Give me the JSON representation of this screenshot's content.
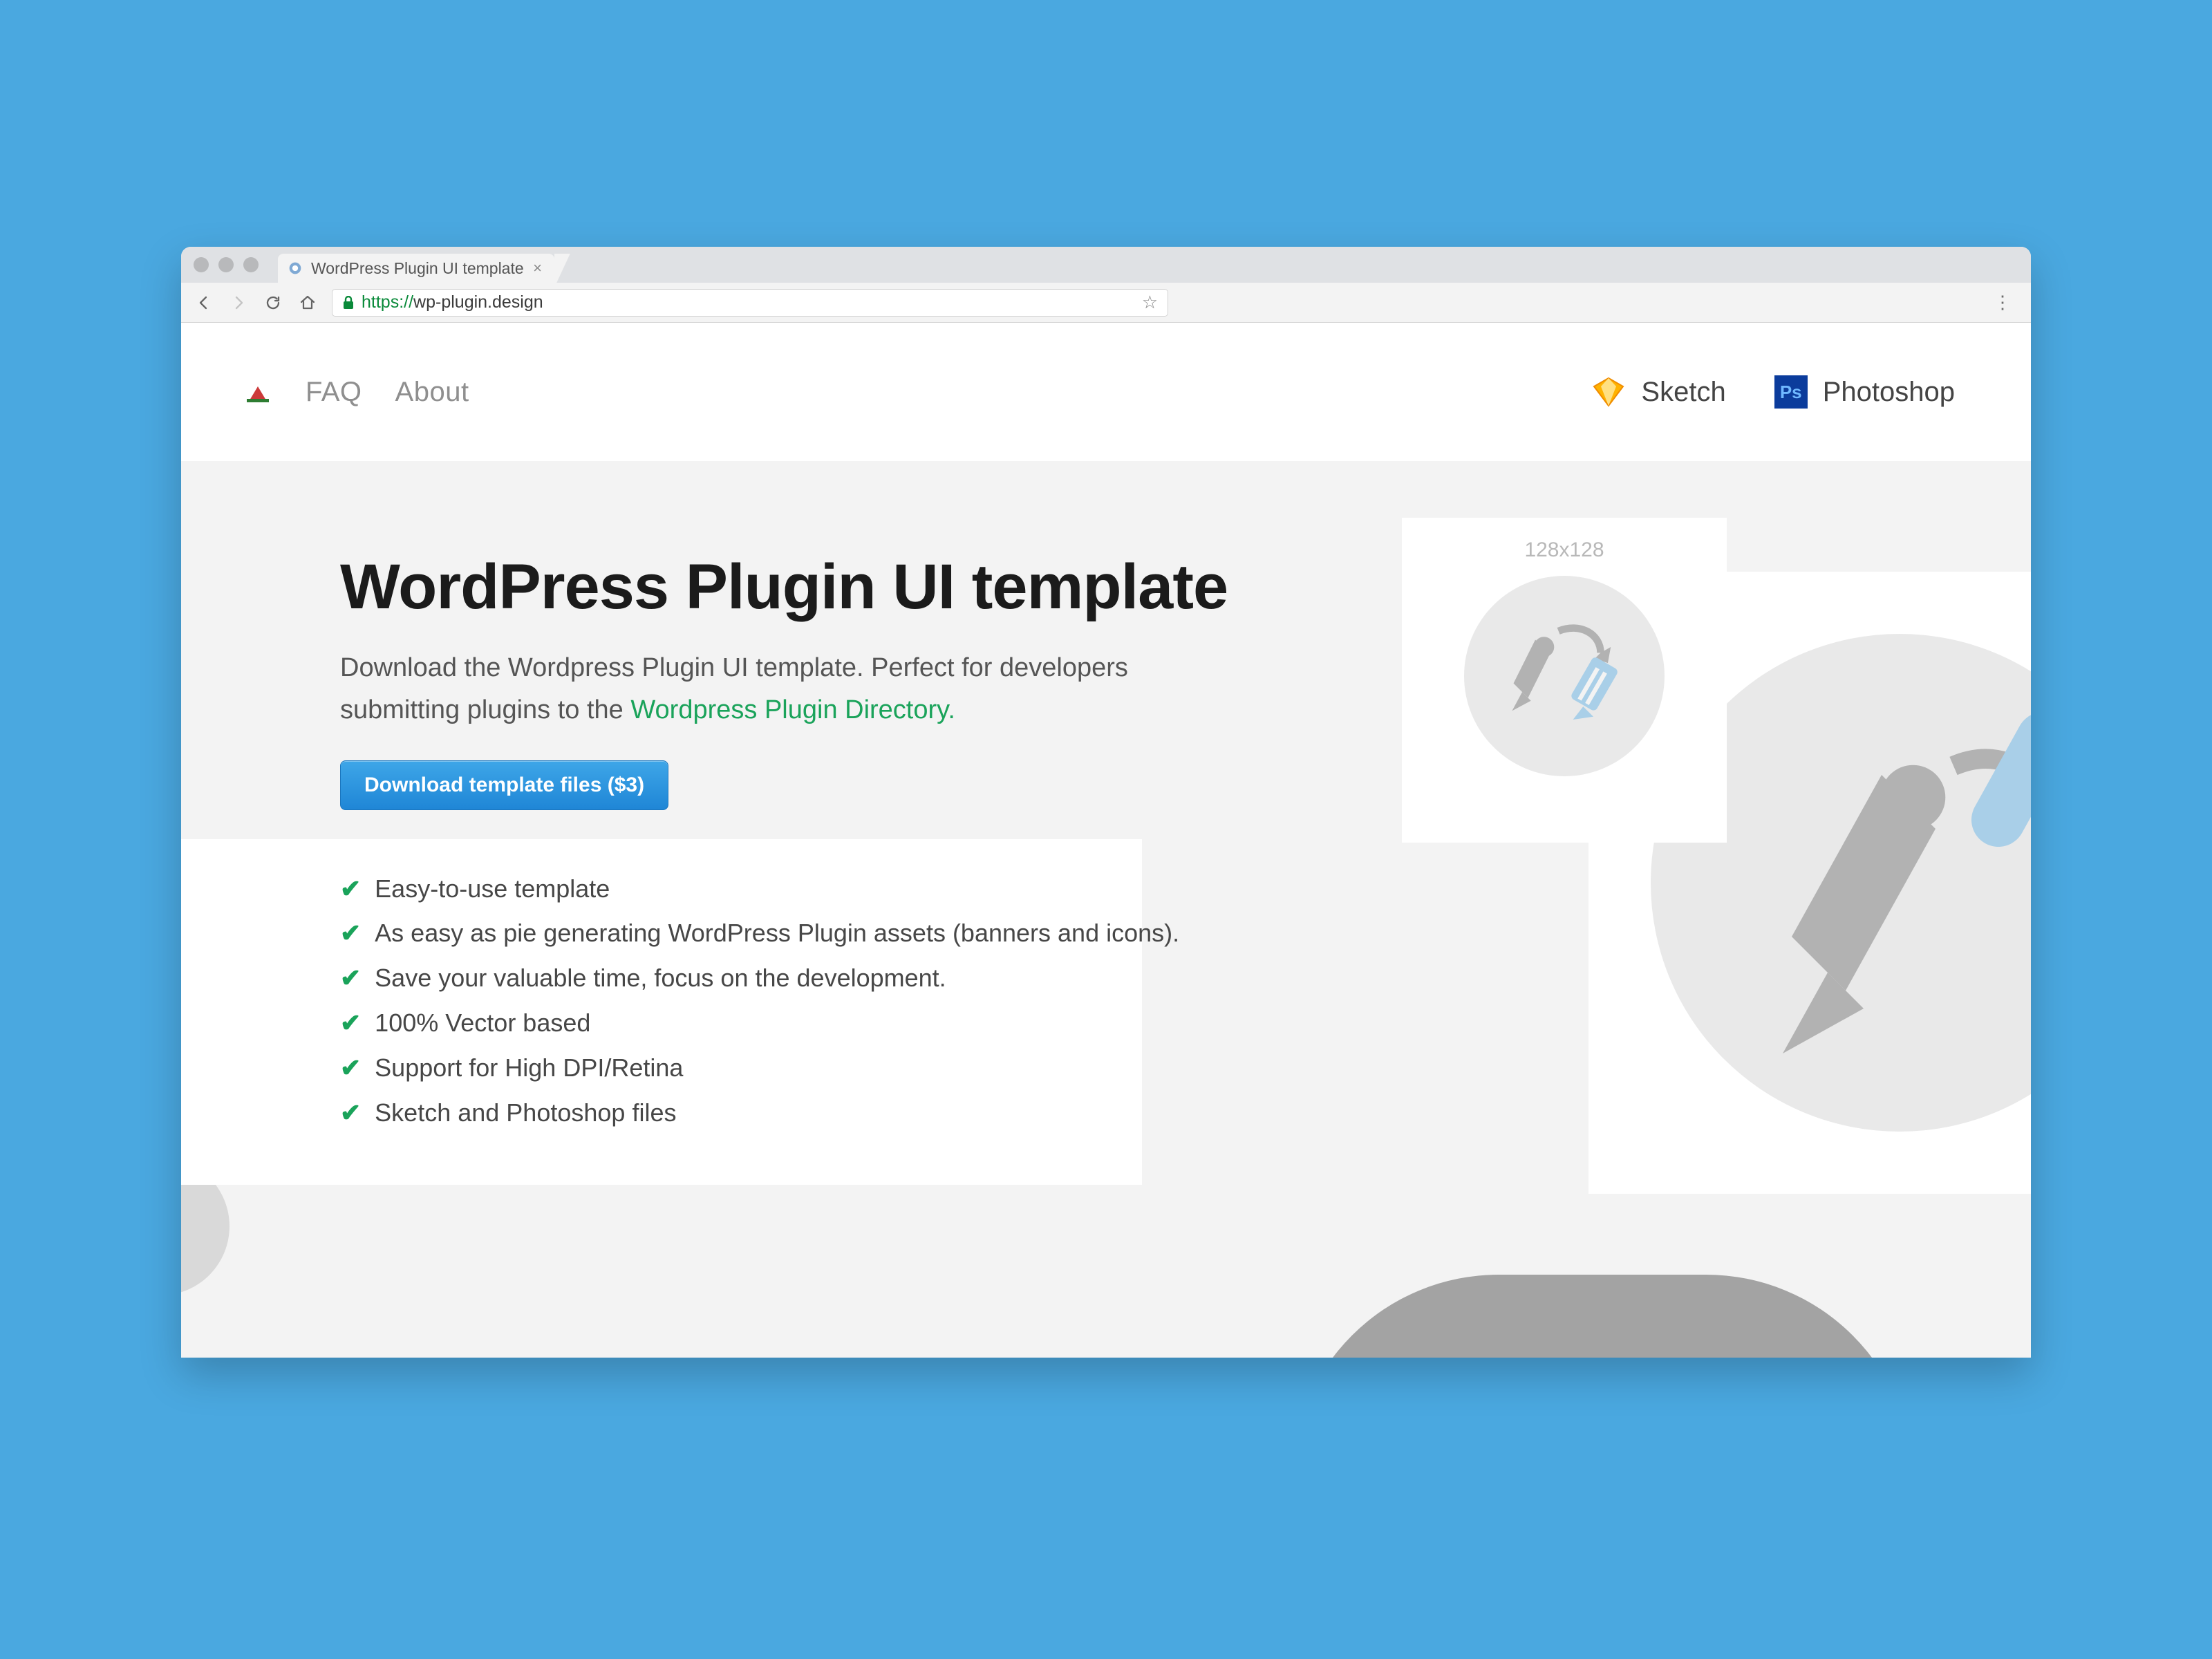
{
  "browser": {
    "tab_title": "WordPress Plugin UI template",
    "url_protocol": "https://",
    "url_host": "wp-plugin.design"
  },
  "nav": {
    "faq": "FAQ",
    "about": "About",
    "sketch": "Sketch",
    "photoshop": "Photoshop",
    "ps_badge": "Ps"
  },
  "hero": {
    "title": "WordPress Plugin UI template",
    "sub_pre": "Download the Wordpress Plugin UI template. Perfect for developers submitting plugins to the ",
    "sub_link": "Wordpress Plugin Directory.",
    "cta": "Download template files ($3)"
  },
  "features": [
    "Easy-to-use template",
    "As easy as pie generating WordPress Plugin assets (banners and icons).",
    "Save your valuable time, focus on the development.",
    "100% Vector based",
    "Support for High DPI/Retina",
    "Sketch and Photoshop files"
  ],
  "preview": {
    "small_label": "128x128"
  }
}
